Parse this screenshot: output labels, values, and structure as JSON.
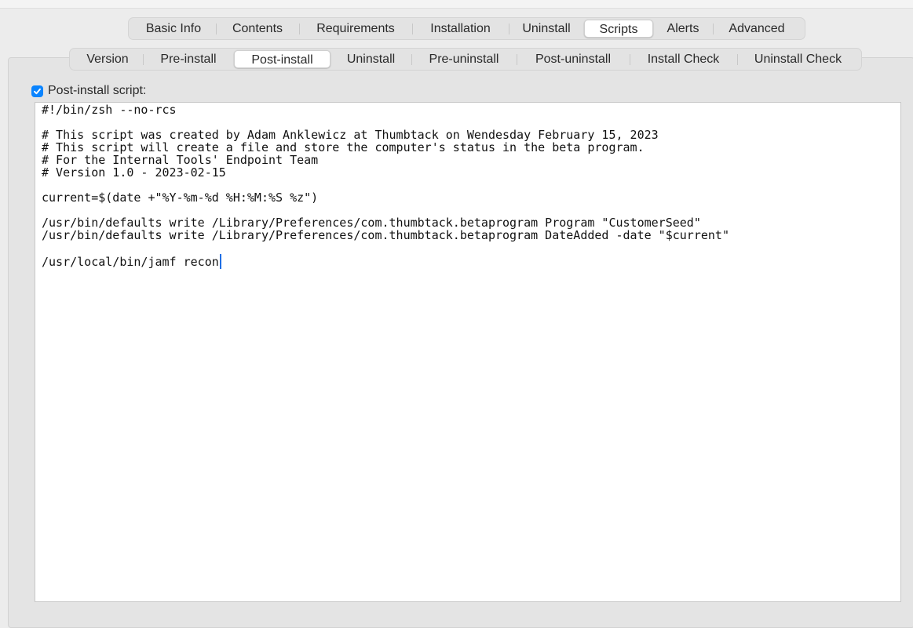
{
  "tabs_top": [
    {
      "label": "Basic Info"
    },
    {
      "label": "Contents"
    },
    {
      "label": "Requirements"
    },
    {
      "label": "Installation"
    },
    {
      "label": "Uninstall"
    },
    {
      "label": "Scripts",
      "active": true
    },
    {
      "label": "Alerts"
    },
    {
      "label": "Advanced"
    }
  ],
  "tabs_sub": [
    {
      "label": "Version"
    },
    {
      "label": "Pre-install"
    },
    {
      "label": "Post-install",
      "active": true
    },
    {
      "label": "Uninstall"
    },
    {
      "label": "Pre-uninstall"
    },
    {
      "label": "Post-uninstall"
    },
    {
      "label": "Install Check"
    },
    {
      "label": "Uninstall Check"
    }
  ],
  "script_checkbox": {
    "label": "Post-install script:",
    "checked": true
  },
  "editor": {
    "lines": [
      "#!/bin/zsh --no-rcs",
      "",
      "# This script was created by Adam Anklewicz at Thumbtack on Wendesday February 15, 2023",
      "# This script will create a file and store the computer's status in the beta program.",
      "# For the Internal Tools' Endpoint Team",
      "# Version 1.0 - 2023-02-15",
      "",
      "current=$(date +\"%Y-%m-%d %H:%M:%S %z\")",
      "",
      "/usr/bin/defaults write /Library/Preferences/com.thumbtack.betaprogram Program \"CustomerSeed\"",
      "/usr/bin/defaults write /Library/Preferences/com.thumbtack.betaprogram DateAdded -date \"$current\"",
      "",
      "/usr/local/bin/jamf recon"
    ]
  },
  "colors": {
    "accent": "#0a84ff",
    "caret": "#1f6fe5",
    "background": "#ececec"
  }
}
